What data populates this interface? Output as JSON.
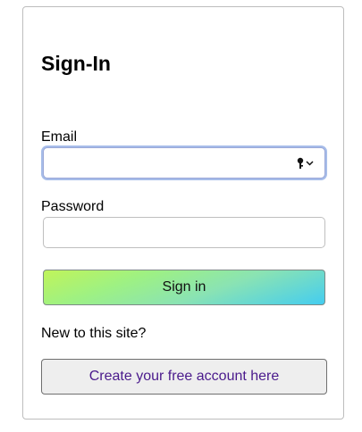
{
  "signin": {
    "title": "Sign-In",
    "email_label": "Email",
    "email_value": "",
    "password_label": "Password",
    "password_value": "",
    "submit_label": "Sign in",
    "new_user_text": "New to this site?",
    "create_account_label": "Create your free account here"
  },
  "colors": {
    "focus_ring": "#a7bde9",
    "create_link_text": "#4a1a8c",
    "signin_gradient": [
      "#c0f45a",
      "#8ae3b3",
      "#44cdf0"
    ]
  },
  "icons": {
    "email_field_autofill": "key-icon"
  }
}
